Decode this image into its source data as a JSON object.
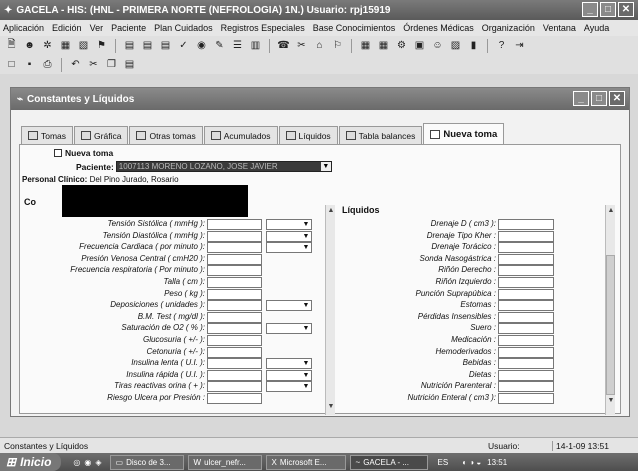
{
  "window": {
    "title": "GACELA - HIS: (HNL - PRIMERA NORTE (NEFROLOGIA) 1N.)     Usuario: rpj15919",
    "min": "_",
    "max": "□",
    "close": "✕"
  },
  "menu": [
    "Aplicación",
    "Edición",
    "Ver",
    "Paciente",
    "Plan Cuidados",
    "Registros Especiales",
    "Base Conocimientos",
    "Órdenes Médicas",
    "Organización",
    "Ventana",
    "Ayuda"
  ],
  "inner": {
    "title": "Constantes y Líquidos",
    "tabs": [
      "Tomas",
      "Gráfica",
      "Otras tomas",
      "Acumulados",
      "Líquidos",
      "Tabla balances",
      "Nueva toma"
    ]
  },
  "form": {
    "checkbox_label": "Nueva toma",
    "patient_label": "Paciente:",
    "patient_value": "1007113 MORENO LOZANO, JOSE JAVIER",
    "staff_label": "Personal Clínico:",
    "staff_value": "Del Pino Jurado, Rosario",
    "const_heading": "Co",
    "liquids_heading": "Líquidos"
  },
  "constants": [
    {
      "label": "Tensión Sistólica ( mmHg ):",
      "dd": true
    },
    {
      "label": "Tensión Diastólica ( mmHg ):",
      "dd": true
    },
    {
      "label": "Frecuencia Cardiaca ( por minuto ):",
      "dd": true
    },
    {
      "label": "Presión Venosa Central ( cmH20 ):",
      "dd": false
    },
    {
      "label": "Frecuencia respiratoria ( Por minuto ):",
      "dd": false
    },
    {
      "label": "Talla ( cm ):",
      "dd": false
    },
    {
      "label": "Peso ( kg ):",
      "dd": false
    },
    {
      "label": "Deposiciones ( unidades ):",
      "dd": true
    },
    {
      "label": "B.M. Test ( mg/dl ):",
      "dd": false
    },
    {
      "label": "Saturación de O2 ( % ):",
      "dd": true
    },
    {
      "label": "Glucosuria ( +/- ):",
      "dd": false
    },
    {
      "label": "Cetonuria ( +/- ):",
      "dd": false
    },
    {
      "label": "Insulina lenta ( U.I. ):",
      "dd": true
    },
    {
      "label": "Insulina rápida ( U.I. ):",
      "dd": true
    },
    {
      "label": "Tiras reactivas orina ( + ):",
      "dd": true
    },
    {
      "label": "Riesgo Ulcera por Presión :",
      "dd": false
    }
  ],
  "liquids": [
    "Drenaje D ( cm3 ):",
    "Drenaje Tipo Kher :",
    "Drenaje Torácico :",
    "Sonda Nasogástrica :",
    "Riñón Derecho :",
    "Riñón Izquierdo :",
    "Punción Suprapúbica :",
    "Estomas :",
    "Pérdidas Insensibles :",
    "Suero :",
    "Medicación :",
    "Hemoderivados :",
    "Bebidas :",
    "Dietas :",
    "Nutrición Parenteral :",
    "Nutrición Enteral ( cm3 ):"
  ],
  "status": {
    "left": "Constantes y Líquidos",
    "user": "Usuario:",
    "datetime": "14-1-09 13:51"
  },
  "taskbar": {
    "start": "Inicio",
    "tasks": [
      "Disco de 3...",
      "ulcer_nefr...",
      "Microsoft E...",
      "GACELA - ..."
    ],
    "lang": "ES",
    "clock": "13:51"
  },
  "colors": {
    "titlebar": "#5a5a5a",
    "panel": "#fafafa",
    "desktop": "#d8d8d8"
  }
}
